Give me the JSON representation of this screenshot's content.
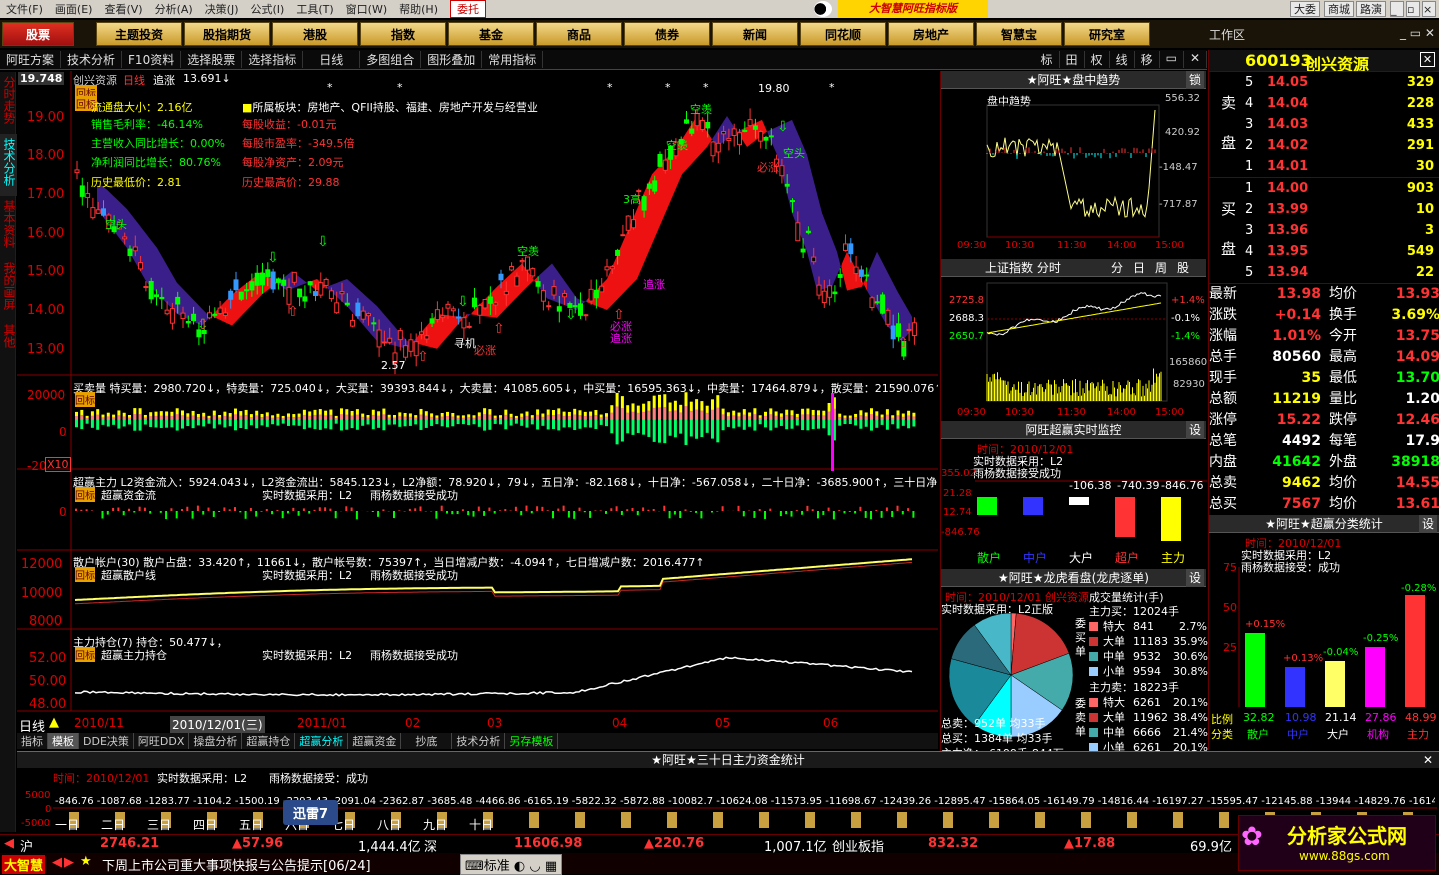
{
  "menu": {
    "items": [
      "文件(F)",
      "画面(E)",
      "查看(V)",
      "分析(A)",
      "决策(J)",
      "公式(I)",
      "工具(T)",
      "窗口(W)",
      "帮助(H)"
    ],
    "entrust": "委托",
    "brand": "大智慧阿旺指标版",
    "right": [
      "大委",
      "商城",
      "路演"
    ]
  },
  "nav": {
    "items": [
      "股票",
      "主题投资",
      "股指期货",
      "港股",
      "指数",
      "基金",
      "商品",
      "债券",
      "新闻",
      "同花顺",
      "房地产",
      "智慧宝",
      "研究室"
    ],
    "workspace": "工作区"
  },
  "toolbar": {
    "items": [
      "阿旺方案",
      "技术分析",
      "F10资料",
      "选择股票",
      "选择指标",
      "日线",
      "多图组合",
      "图形叠加",
      "常用指标"
    ],
    "right": [
      "标",
      "田",
      "权",
      "线",
      "移"
    ]
  },
  "side": {
    "items": [
      "分时走势",
      "技术分析",
      "基本资料",
      "我的画屏",
      "其他"
    ]
  },
  "colors": {
    "up": "#ff3333",
    "down": "#00ff00",
    "bg": "#000000",
    "accent": "#ffd400"
  },
  "main": {
    "price_box": "19.748",
    "title": "创兴资源",
    "period": "日线",
    "indicator": "追涨",
    "indicator_val": "13.691↓",
    "info_left": [
      "流通盘大小：2.16亿",
      "销售毛利率：-46.14%",
      "主营收入同比增长：0.00%",
      "净利润同比增长：80.76%",
      "历史最低价：2.81"
    ],
    "info_right": [
      "所属板块：房地产、QFII持股、福建、房地产开发与经营业",
      "每股收益：-0.01元",
      "每股市盈率：-349.5倍",
      "每股净资产：2.09元",
      "历史最高价：29.88"
    ],
    "y_labels": [
      "19.00",
      "18.00",
      "17.00",
      "16.00",
      "15.00",
      "14.00",
      "13.00"
    ],
    "annotations": [
      {
        "t": "空头"
      },
      {
        "t": "空羡"
      },
      {
        "t": "空头"
      },
      {
        "t": "追涨"
      },
      {
        "t": "必涨"
      },
      {
        "t": "追涨"
      },
      {
        "t": "寻机"
      },
      {
        "t": "必涨"
      },
      {
        "t": "空羡"
      },
      {
        "t": "空羡"
      },
      {
        "t": "3高"
      },
      {
        "t": "2.57"
      },
      {
        "t": "19.80"
      },
      {
        "t": "必涨"
      }
    ],
    "markers": [
      "*",
      "*",
      "*",
      "*",
      "*",
      "*"
    ],
    "vol_header": "买卖量  特买量：2980.720↓，特卖量：725.040↓，大买量：39393.844↓，大卖量：41085.605↓，中买量：16595.363↓，中卖量：17464.879↓，散买量：21590.076↑，散",
    "vol_y": [
      "20000",
      "0",
      "-20"
    ],
    "vol_x10": "X10",
    "main_force_header": "超赢主力  L2资金流入：5924.043↓，L2资金流出：5845.123↓，L2净额：78.920↓，79↓，五日净：-82.168↓，十日净：-567.058↓，二十日净：-3685.900↑，三十日净：",
    "main_force_sub": [
      "超赢资金流",
      "实时数据采用：L2",
      "雨杨数据接受成功"
    ],
    "retail_header": "散户帐户(30) 散户占盘：33.420↑，11661↓，散户帐号数：75397↑，当日增减户数：-4.094↑，七日增减户数：2016.477↑",
    "retail_sub": [
      "超赢散户线",
      "实时数据采用：L2",
      "雨杨数据接受成功"
    ],
    "retail_y": [
      "12000",
      "10000",
      "8000"
    ],
    "hold_header": "主力持仓(7) 持仓：50.477↓，",
    "hold_sub": [
      "超赢主力持仓",
      "实时数据采用：L2",
      "雨杨数据接受成功"
    ],
    "hold_y": [
      "52.00",
      "50.00",
      "48.00"
    ],
    "x_axis": {
      "label": "日线",
      "dates": [
        "2010/11",
        "2010/12/01(三)",
        "2011/01",
        "02",
        "03",
        "04",
        "05",
        "06"
      ]
    },
    "buttons": [
      "回标",
      "回标",
      "回标",
      "回标",
      "回标"
    ]
  },
  "bottom_tabs": [
    "指标",
    "模板",
    "DDE决策",
    "阿旺DDX",
    "操盘分析",
    "超赢持仓",
    "超赢分析",
    "超赢资金",
    "抄底",
    "技术分析",
    "另存模板"
  ],
  "capital": {
    "title": "★阿旺★三十日主力资金统计",
    "header": [
      "时间：2010/12/01",
      "实时数据采用：L2",
      "雨杨数据接受：成功"
    ],
    "y": [
      "5000",
      "0",
      "-5000"
    ],
    "values": [
      "-846.76",
      "-1087.68",
      "-1283.77",
      "-1104.2",
      "-1500.19",
      "",
      "",
      "-2293.43",
      "-2091.04",
      "-2362.87",
      "-3685.48",
      "-4466.86",
      "-6165.19",
      "-5822.32",
      "-5872.88",
      "-10082.7",
      "-10624.08",
      "-11573.95",
      "-11698.67",
      "-12439.26",
      "-12895.47",
      "-15864.05",
      "-16149.79",
      "-14816.44",
      "-16197.27",
      "-15595.47",
      "-12145.88",
      "-13944",
      "-14829.76",
      "-16149.22",
      "-16149.22"
    ],
    "days": [
      "一日",
      "二日",
      "三日",
      "四日",
      "五日",
      "六日",
      "七日",
      "八日",
      "九日",
      "十日"
    ],
    "xunlei": "迅雷7"
  },
  "status": {
    "sh": "沪",
    "sh_val": "2746.21",
    "sh_chg": "▲57.96",
    "sh_amt": "1,444.4亿",
    "sz": "深",
    "sz_val": "11606.98",
    "sz_chg": "▲220.76",
    "sz_amt": "1,007.1亿",
    "cy": "创业板指",
    "cy_val": "832.32",
    "cy_chg": "▲17.88",
    "cy_amt": "69.9亿",
    "ticker": "下周上市公司重大事项快报与公告提示[06/24]",
    "std": "标准",
    "logo": "大智慧"
  },
  "mid": {
    "trend_title": "★阿旺★盘中趋势",
    "trend_lock": "锁",
    "trend_label": "盘中趋势",
    "trend_y": [
      "556.32",
      "420.92",
      "-148.47",
      "-717.87"
    ],
    "trend_x": [
      "09:30",
      "10:30",
      "11:30",
      "14:00",
      "15:00"
    ],
    "index_title": "上证指数  分时",
    "index_tabs": [
      "分",
      "日",
      "周",
      "股"
    ],
    "index_y": [
      "2725.8",
      "2688.3",
      "2650.7"
    ],
    "index_pct": [
      "+1.4%",
      "-0.1%",
      "-1.4%"
    ],
    "index_vol": [
      "165860",
      "82930"
    ],
    "index_x": [
      "09:30",
      "10:30",
      "11:30",
      "14:00",
      "15:00"
    ],
    "monitor_title": "阿旺超赢实时监控",
    "monitor_set": "设",
    "monitor_lines": [
      "时间：2010/12/01",
      "实时数据采用：L2",
      "雨杨数据接受成功"
    ],
    "monitor_y": [
      "355.02",
      "21.28",
      "12.74",
      "-846.76"
    ],
    "monitor_vals": [
      "-106.38",
      "-740.39",
      "-846.76"
    ],
    "monitor_cats": [
      "散户",
      "中户",
      "大户",
      "超户",
      "主力"
    ],
    "dragon_title": "★阿旺★龙虎看盘(龙虎逐单)",
    "dragon_set": "设",
    "dragon_sub": "时间：2010/12/01  创兴资源",
    "dragon_live": "实时数据采用：L2正版",
    "dragon_stats_title": "成交量统计(手)",
    "buy_title": "主力买：12024手",
    "buy_rows": [
      [
        "特大",
        "841",
        "2.7%"
      ],
      [
        "大单",
        "11183",
        "35.9%"
      ],
      [
        "中单",
        "9532",
        "30.6%"
      ],
      [
        "小单",
        "9594",
        "30.8%"
      ]
    ],
    "sell_title": "主力卖：18223手",
    "sell_rows": [
      [
        "特大",
        "6261",
        "20.1%"
      ],
      [
        "大单",
        "11962",
        "38.4%"
      ],
      [
        "中单",
        "6666",
        "21.4%"
      ],
      [
        "小单",
        "6261",
        "20.1%"
      ]
    ],
    "totals": [
      "总卖：952单  均33手",
      "总买：1384单  均33手",
      "主力净：-6199手-844万"
    ],
    "side_labels": [
      "委",
      "买",
      "单",
      "委",
      "卖",
      "单"
    ]
  },
  "right": {
    "code": "600193",
    "name": "创兴资源",
    "sell_label": [
      "卖",
      "盘"
    ],
    "buy_label": [
      "买",
      "盘"
    ],
    "asks": [
      [
        "5",
        "14.05",
        "329"
      ],
      [
        "4",
        "14.04",
        "228"
      ],
      [
        "3",
        "14.03",
        "433"
      ],
      [
        "2",
        "14.02",
        "291"
      ],
      [
        "1",
        "14.01",
        "30"
      ]
    ],
    "bids": [
      [
        "1",
        "14.00",
        "903"
      ],
      [
        "2",
        "13.99",
        "10"
      ],
      [
        "3",
        "13.96",
        "3"
      ],
      [
        "4",
        "13.95",
        "549"
      ],
      [
        "5",
        "13.94",
        "22"
      ]
    ],
    "quote": [
      [
        "最新",
        "13.98",
        "均价",
        "13.93"
      ],
      [
        "涨跌",
        "+0.14",
        "换手",
        "3.69%"
      ],
      [
        "涨幅",
        "1.01%",
        "今开",
        "13.75"
      ],
      [
        "总手",
        "80560",
        "最高",
        "14.09"
      ],
      [
        "现手",
        "35",
        "最低",
        "13.70"
      ],
      [
        "总额",
        "11219",
        "量比",
        "1.20"
      ],
      [
        "涨停",
        "15.22",
        "跌停",
        "12.46"
      ],
      [
        "总笔",
        "4492",
        "每笔",
        "17.9"
      ],
      [
        "内盘",
        "41642",
        "外盘",
        "38918"
      ],
      [
        "总卖",
        "9462",
        "均价",
        "14.55"
      ],
      [
        "总买",
        "7567",
        "均价",
        "13.61"
      ]
    ],
    "stat_title": "★阿旺★超赢分类统计",
    "stat_set": "设",
    "stat_lines": [
      "时间：2010/12/01",
      "实时数据采用：L2",
      "雨杨数据接受：成功"
    ],
    "stat_y": [
      "75",
      "50",
      "25"
    ],
    "stat_pcts": [
      "+0.15%",
      "+0.13%",
      "-0.04%",
      "-0.25%",
      "-0.28%"
    ],
    "stat_ratio_label": "比例",
    "stat_ratios": [
      "32.82",
      "10.98",
      "21.14",
      "27.86",
      "48.99"
    ],
    "stat_div_label": "分类",
    "stat_cats": [
      "散户",
      "中户",
      "大户",
      "机构",
      "主力"
    ]
  },
  "watermark": {
    "text": "分析家公式网",
    "url": "www.88gs.com"
  }
}
